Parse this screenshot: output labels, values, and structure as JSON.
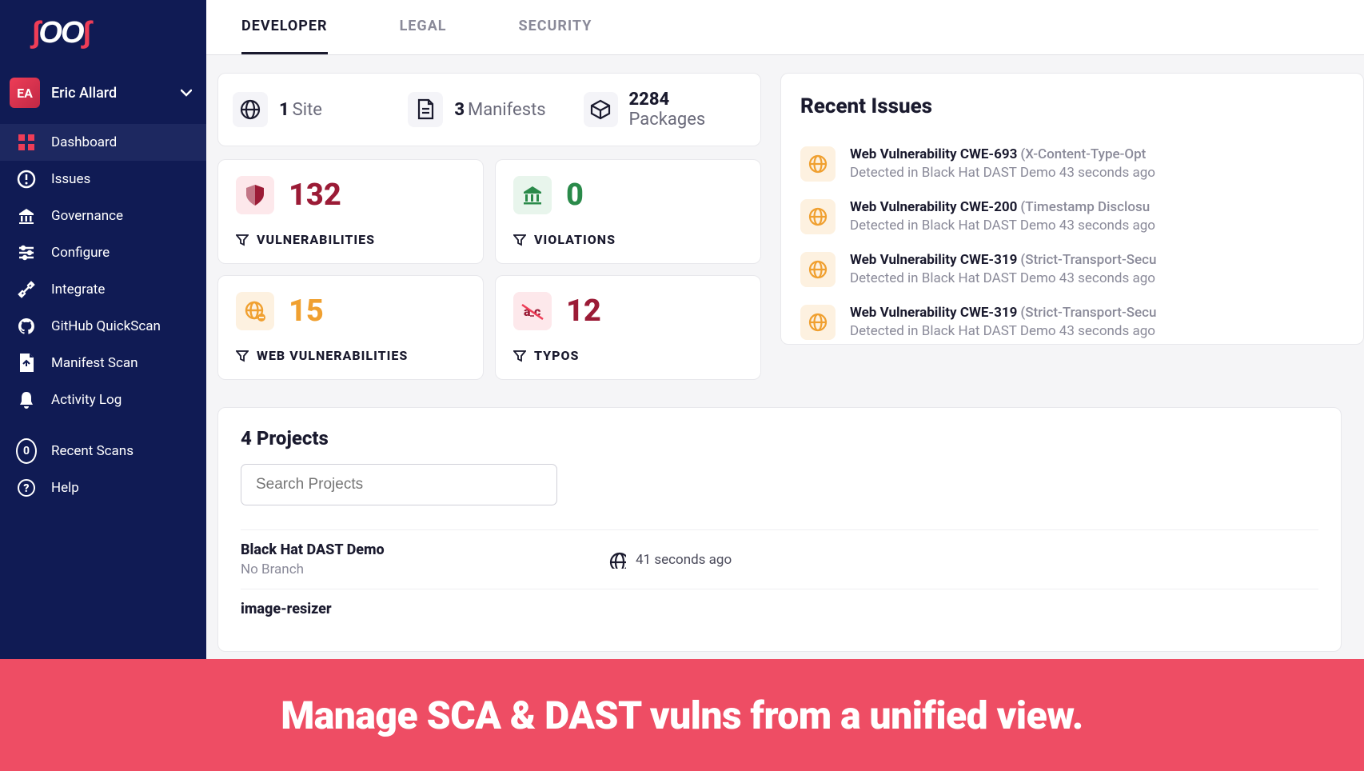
{
  "logo": "SOOS",
  "user": {
    "initials": "EA",
    "name": "Eric Allard"
  },
  "sidebar": {
    "items": [
      {
        "label": "Dashboard",
        "icon": "dashboard",
        "active": true
      },
      {
        "label": "Issues",
        "icon": "issues"
      },
      {
        "label": "Governance",
        "icon": "governance"
      },
      {
        "label": "Configure",
        "icon": "configure"
      },
      {
        "label": "Integrate",
        "icon": "integrate"
      },
      {
        "label": "GitHub QuickScan",
        "icon": "github"
      },
      {
        "label": "Manifest Scan",
        "icon": "manifest"
      },
      {
        "label": "Activity Log",
        "icon": "bell"
      }
    ],
    "bottom": [
      {
        "label": "Recent Scans",
        "count": "0"
      },
      {
        "label": "Help",
        "icon": "help"
      }
    ]
  },
  "tabs": [
    {
      "label": "DEVELOPER",
      "active": true
    },
    {
      "label": "LEGAL"
    },
    {
      "label": "SECURITY"
    }
  ],
  "stats": [
    {
      "count": "1",
      "label": "Site",
      "icon": "globe"
    },
    {
      "count": "3",
      "label": "Manifests",
      "icon": "file"
    },
    {
      "count": "2284",
      "label": "Packages",
      "icon": "package"
    }
  ],
  "cards": [
    {
      "num": "132",
      "label": "VULNERABILITIES",
      "icon": "shield",
      "color": "red"
    },
    {
      "num": "0",
      "label": "VIOLATIONS",
      "icon": "bank",
      "color": "green"
    },
    {
      "num": "15",
      "label": "WEB VULNERABILITIES",
      "icon": "globe-x",
      "color": "orange"
    },
    {
      "num": "12",
      "label": "TYPOS",
      "icon": "typo",
      "color": "red"
    }
  ],
  "recent": {
    "title": "Recent Issues",
    "items": [
      {
        "title": "Web Vulnerability CWE-693",
        "sub": "(X-Content-Type-Opt",
        "detail": "Detected in Black Hat DAST Demo 43 seconds ago"
      },
      {
        "title": "Web Vulnerability CWE-200",
        "sub": "(Timestamp Disclosu",
        "detail": "Detected in Black Hat DAST Demo 43 seconds ago"
      },
      {
        "title": "Web Vulnerability CWE-319",
        "sub": "(Strict-Transport-Secu",
        "detail": "Detected in Black Hat DAST Demo 43 seconds ago"
      },
      {
        "title": "Web Vulnerability CWE-319",
        "sub": "(Strict-Transport-Secu",
        "detail": "Detected in Black Hat DAST Demo 43 seconds ago"
      }
    ]
  },
  "projects": {
    "title": "4 Projects",
    "search_placeholder": "Search Projects",
    "items": [
      {
        "name": "Black Hat DAST Demo",
        "branch": "No Branch",
        "time": "41 seconds ago"
      },
      {
        "name": "image-resizer",
        "branch": "",
        "time": ""
      }
    ]
  },
  "banner": "Manage SCA & DAST vulns from a unified view."
}
